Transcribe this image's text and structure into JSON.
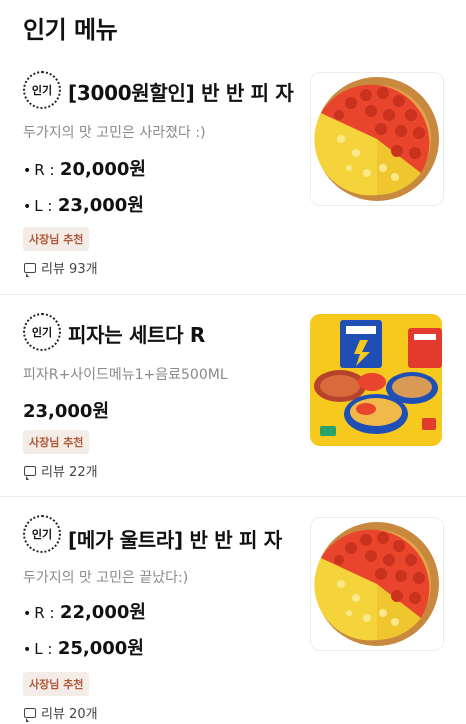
{
  "section": {
    "title": "인기 메뉴"
  },
  "items": [
    {
      "badge": "인기",
      "name": "[3000원할인] 반 반 피 자",
      "desc": "두가지의 맛 고민은 사라졌다 :)",
      "prices": [
        {
          "bullet": "•",
          "size": "R :",
          "amount": "20,000원"
        },
        {
          "bullet": "•",
          "size": "L :",
          "amount": "23,000원"
        }
      ],
      "tag": "사장님 추천",
      "review": "리뷰 93개",
      "image": "half-half-pizza"
    },
    {
      "badge": "인기",
      "name": "피자는 세트다 R",
      "desc": "피자R+사이드메뉴1+음료500ML",
      "price": "23,000원",
      "tag": "사장님 추천",
      "review": "리뷰 22개",
      "image": "pizza-set-boxes"
    },
    {
      "badge": "인기",
      "name": "[메가 울트라] 반 반 피 자",
      "desc": "두가지의 맛 고민은 끝났다:)",
      "prices": [
        {
          "bullet": "•",
          "size": "R :",
          "amount": "22,000원"
        },
        {
          "bullet": "•",
          "size": "L :",
          "amount": "25,000원"
        }
      ],
      "tag": "사장님 추천",
      "review": "리뷰 20개",
      "image": "half-half-pizza"
    }
  ],
  "colors": {
    "pepperoni": "#e8452c",
    "cheese": "#f5d33a",
    "crust": "#c8893e",
    "tag_bg": "#f4ece6",
    "tag_text": "#b0583a"
  }
}
